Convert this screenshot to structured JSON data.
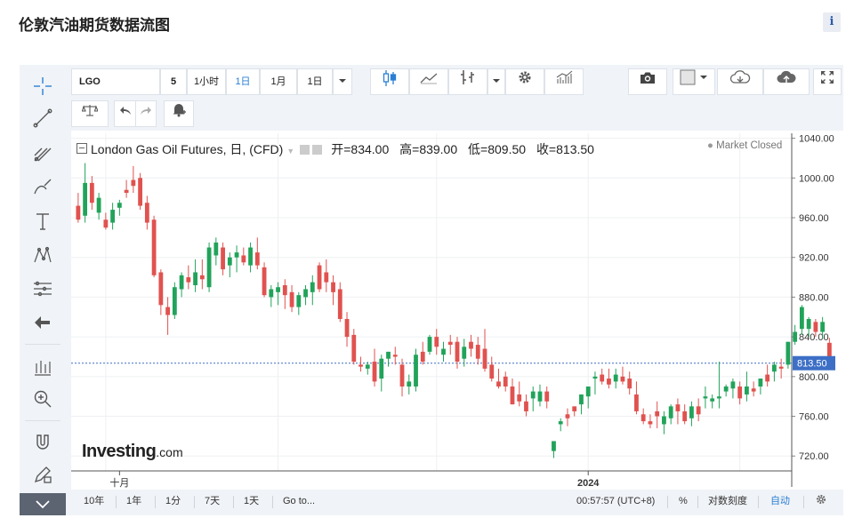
{
  "page": {
    "title": "伦敦汽油期货数据流图",
    "info_icon": "i"
  },
  "toolbar": {
    "symbol": "LGO",
    "interval_number": "5",
    "intervals": [
      "1小时",
      "1日",
      "1月",
      "1日"
    ],
    "active_interval": "1日",
    "icons": [
      "candlestick-icon",
      "line-chart-icon",
      "bar-compare-icon",
      "dropdown-icon",
      "gear-icon",
      "indicators-icon",
      "camera-icon",
      "color-swatch-icon",
      "cloud-download-icon",
      "cloud-upload-icon",
      "fullscreen-icon"
    ]
  },
  "toolbar2": {
    "icons": [
      "scale-icon",
      "undo-icon",
      "redo-icon",
      "alert-icon"
    ]
  },
  "left_tools": [
    "crosshair-icon",
    "trendline-icon",
    "pitchfork-icon",
    "brush-icon",
    "text-icon",
    "pattern-icon",
    "fib-icon",
    "back-arrow-icon",
    "measure-icon",
    "zoom-icon",
    "magnet-icon",
    "lock-pencil-icon",
    "collapse-icon"
  ],
  "legend": {
    "name": "London Gas Oil Futures, 日, (CFD)",
    "open_label": "开=",
    "open": "834.00",
    "high_label": "高=",
    "high": "839.00",
    "low_label": "低=",
    "low": "809.50",
    "close_label": "收=",
    "close": "813.50"
  },
  "status": {
    "market": "Market Closed"
  },
  "logo": {
    "text": "Investing",
    "suffix": ".com"
  },
  "bottombar": {
    "ranges": [
      "10年",
      "1年",
      "1分",
      "7天",
      "1天"
    ],
    "goto": "Go to...",
    "time": "00:57:57 (UTC+8)",
    "percent": "%",
    "log": "对数刻度",
    "auto": "自动"
  },
  "colors": {
    "up": "#21a35a",
    "down": "#e0524f",
    "grid": "#eef0f3",
    "price_line": "#3d6fc6",
    "active": "#2a7fd4"
  },
  "chart_data": {
    "type": "candlestick",
    "y_ticks": [
      "1040.00",
      "1000.00",
      "960.00",
      "920.00",
      "880.00",
      "840.00",
      "800.00",
      "760.00",
      "720.00"
    ],
    "ylim": [
      705,
      1045
    ],
    "x_labels": [
      {
        "label": "十月",
        "index": 6
      },
      {
        "label": "2024",
        "index": 74
      }
    ],
    "last_price": "813.50",
    "candles": [
      [
        972,
        985,
        955,
        958
      ],
      [
        962,
        1015,
        955,
        995
      ],
      [
        995,
        1002,
        968,
        975
      ],
      [
        965,
        985,
        958,
        980
      ],
      [
        958,
        965,
        948,
        950
      ],
      [
        955,
        975,
        948,
        968
      ],
      [
        970,
        978,
        962,
        975
      ],
      [
        988,
        998,
        980,
        985
      ],
      [
        998,
        1012,
        985,
        992
      ],
      [
        1000,
        1005,
        968,
        972
      ],
      [
        975,
        982,
        948,
        955
      ],
      [
        958,
        962,
        900,
        902
      ],
      [
        905,
        908,
        862,
        872
      ],
      [
        870,
        880,
        842,
        862
      ],
      [
        862,
        895,
        858,
        890
      ],
      [
        888,
        905,
        880,
        902
      ],
      [
        900,
        912,
        888,
        895
      ],
      [
        892,
        918,
        885,
        905
      ],
      [
        902,
        918,
        888,
        898
      ],
      [
        890,
        935,
        885,
        930
      ],
      [
        922,
        940,
        912,
        935
      ],
      [
        930,
        935,
        902,
        908
      ],
      [
        912,
        925,
        900,
        920
      ],
      [
        920,
        932,
        905,
        925
      ],
      [
        922,
        930,
        912,
        915
      ],
      [
        912,
        935,
        905,
        930
      ],
      [
        925,
        940,
        908,
        912
      ],
      [
        910,
        915,
        880,
        882
      ],
      [
        880,
        892,
        870,
        888
      ],
      [
        885,
        895,
        872,
        890
      ],
      [
        892,
        898,
        868,
        882
      ],
      [
        885,
        892,
        865,
        870
      ],
      [
        870,
        885,
        862,
        882
      ],
      [
        880,
        892,
        872,
        888
      ],
      [
        885,
        902,
        872,
        895
      ],
      [
        912,
        915,
        885,
        888
      ],
      [
        905,
        918,
        885,
        895
      ],
      [
        895,
        902,
        872,
        885
      ],
      [
        888,
        895,
        855,
        858
      ],
      [
        858,
        865,
        830,
        840
      ],
      [
        842,
        848,
        812,
        815
      ],
      [
        812,
        820,
        805,
        810
      ],
      [
        808,
        815,
        802,
        812
      ],
      [
        815,
        828,
        790,
        795
      ],
      [
        798,
        822,
        785,
        818
      ],
      [
        818,
        825,
        810,
        825
      ],
      [
        822,
        830,
        812,
        820
      ],
      [
        812,
        818,
        780,
        790
      ],
      [
        790,
        802,
        782,
        795
      ],
      [
        790,
        828,
        785,
        822
      ],
      [
        825,
        835,
        812,
        815
      ],
      [
        825,
        842,
        822,
        840
      ],
      [
        840,
        848,
        822,
        830
      ],
      [
        822,
        835,
        815,
        828
      ],
      [
        835,
        842,
        822,
        832
      ],
      [
        835,
        840,
        808,
        815
      ],
      [
        818,
        838,
        810,
        830
      ],
      [
        835,
        842,
        820,
        828
      ],
      [
        832,
        840,
        812,
        818
      ],
      [
        828,
        848,
        805,
        808
      ],
      [
        812,
        820,
        795,
        798
      ],
      [
        795,
        808,
        788,
        790
      ],
      [
        800,
        805,
        785,
        790
      ],
      [
        790,
        798,
        772,
        772
      ],
      [
        782,
        795,
        770,
        775
      ],
      [
        775,
        782,
        760,
        765
      ],
      [
        778,
        790,
        765,
        785
      ],
      [
        775,
        792,
        770,
        785
      ],
      [
        785,
        790,
        768,
        775
      ],
      [
        725,
        735,
        718,
        735
      ],
      [
        752,
        758,
        745,
        755
      ],
      [
        762,
        768,
        750,
        758
      ],
      [
        770,
        770,
        760,
        765
      ],
      [
        772,
        782,
        762,
        782
      ],
      [
        780,
        788,
        768,
        790
      ],
      [
        798,
        805,
        782,
        800
      ],
      [
        802,
        808,
        792,
        795
      ],
      [
        798,
        808,
        788,
        792
      ],
      [
        795,
        808,
        788,
        802
      ],
      [
        800,
        810,
        792,
        795
      ],
      [
        798,
        805,
        782,
        788
      ],
      [
        782,
        795,
        762,
        765
      ],
      [
        762,
        768,
        752,
        755
      ],
      [
        755,
        762,
        748,
        752
      ],
      [
        765,
        775,
        748,
        760
      ],
      [
        752,
        765,
        742,
        760
      ],
      [
        758,
        772,
        752,
        770
      ],
      [
        772,
        778,
        752,
        765
      ],
      [
        765,
        772,
        752,
        755
      ],
      [
        758,
        775,
        750,
        770
      ],
      [
        770,
        778,
        755,
        762
      ],
      [
        778,
        790,
        768,
        780
      ],
      [
        775,
        782,
        768,
        778
      ],
      [
        778,
        815,
        768,
        780
      ],
      [
        785,
        792,
        780,
        790
      ],
      [
        788,
        798,
        778,
        795
      ],
      [
        790,
        795,
        772,
        778
      ],
      [
        782,
        805,
        775,
        790
      ],
      [
        788,
        795,
        780,
        785
      ],
      [
        790,
        798,
        782,
        798
      ],
      [
        802,
        812,
        790,
        795
      ],
      [
        805,
        815,
        795,
        812
      ],
      [
        810,
        818,
        798,
        808
      ],
      [
        812,
        835,
        808,
        835
      ],
      [
        835,
        852,
        832,
        845
      ],
      [
        848,
        872,
        842,
        870
      ],
      [
        848,
        860,
        840,
        858
      ],
      [
        855,
        858,
        840,
        845
      ],
      [
        845,
        860,
        838,
        855
      ],
      [
        834,
        839,
        809,
        813.5
      ]
    ]
  }
}
